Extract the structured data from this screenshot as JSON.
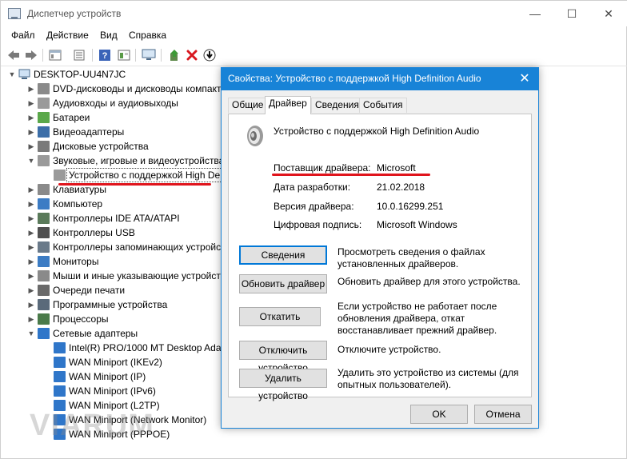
{
  "window": {
    "title": "Диспетчер устройств",
    "minimize": "—",
    "maximize": "☐",
    "close": "✕"
  },
  "menu": [
    "Файл",
    "Действие",
    "Вид",
    "Справка"
  ],
  "tree": {
    "root": "DESKTOP-UU4N7JC",
    "items": [
      {
        "label": "DVD-дисководы и дисководы компакт",
        "icon": "dvd-drive-icon",
        "expanded": false
      },
      {
        "label": "Аудиовходы и аудиовыходы",
        "icon": "speaker-icon",
        "expanded": false
      },
      {
        "label": "Батареи",
        "icon": "battery-icon",
        "expanded": false
      },
      {
        "label": "Видеоадаптеры",
        "icon": "display-adapter-icon",
        "expanded": false
      },
      {
        "label": "Дисковые устройства",
        "icon": "disk-drive-icon",
        "expanded": false
      },
      {
        "label": "Звуковые, игровые и видеоустройства",
        "icon": "speaker-icon",
        "expanded": true
      },
      {
        "label": "Устройство с поддержкой High De",
        "icon": "speaker-icon",
        "child": true,
        "selected": true
      },
      {
        "label": "Клавиатуры",
        "icon": "keyboard-icon",
        "expanded": false
      },
      {
        "label": "Компьютер",
        "icon": "computer-icon",
        "expanded": false
      },
      {
        "label": "Контроллеры IDE ATA/ATAPI",
        "icon": "controller-icon",
        "expanded": false
      },
      {
        "label": "Контроллеры USB",
        "icon": "usb-icon",
        "expanded": false
      },
      {
        "label": "Контроллеры запоминающих устройств",
        "icon": "storage-controller-icon",
        "expanded": false
      },
      {
        "label": "Мониторы",
        "icon": "monitor-icon",
        "expanded": false
      },
      {
        "label": "Мыши и иные указывающие устройст",
        "icon": "mouse-icon",
        "expanded": false
      },
      {
        "label": "Очереди печати",
        "icon": "printer-icon",
        "expanded": false
      },
      {
        "label": "Программные устройства",
        "icon": "software-device-icon",
        "expanded": false
      },
      {
        "label": "Процессоры",
        "icon": "processor-icon",
        "expanded": false
      },
      {
        "label": "Сетевые адаптеры",
        "icon": "network-adapter-icon",
        "expanded": true
      },
      {
        "label": "Intel(R) PRO/1000 MT Desktop Adap",
        "icon": "network-adapter-icon",
        "child": true
      },
      {
        "label": "WAN Miniport (IKEv2)",
        "icon": "network-adapter-icon",
        "child": true
      },
      {
        "label": "WAN Miniport (IP)",
        "icon": "network-adapter-icon",
        "child": true
      },
      {
        "label": "WAN Miniport (IPv6)",
        "icon": "network-adapter-icon",
        "child": true
      },
      {
        "label": "WAN Miniport (L2TP)",
        "icon": "network-adapter-icon",
        "child": true
      },
      {
        "label": "WAN Miniport (Network Monitor)",
        "icon": "network-adapter-icon",
        "child": true
      },
      {
        "label": "WAN Miniport (PPPOE)",
        "icon": "network-adapter-icon",
        "child": true
      }
    ]
  },
  "dialog": {
    "title": "Свойства: Устройство с поддержкой High Definition Audio",
    "close": "✕",
    "tabs": [
      "Общие",
      "Драйвер",
      "Сведения",
      "События"
    ],
    "active_tab": "Драйвер",
    "device_name": "Устройство с поддержкой High Definition Audio",
    "properties": [
      {
        "label": "Поставщик драйвера:",
        "value": "Microsoft"
      },
      {
        "label": "Дата разработки:",
        "value": "21.02.2018"
      },
      {
        "label": "Версия драйвера:",
        "value": "10.0.16299.251"
      },
      {
        "label": "Цифровая подпись:",
        "value": "Microsoft Windows"
      }
    ],
    "actions": [
      {
        "label": "Сведения",
        "desc": "Просмотреть сведения о файлах установленных драйверов."
      },
      {
        "label": "Обновить драйвер",
        "desc": "Обновить драйвер для этого устройства."
      },
      {
        "label": "Откатить",
        "desc": "Если устройство не работает после обновления драйвера, откат восстанавливает прежний драйвер."
      },
      {
        "label": "Отключить устройство",
        "desc": "Отключите устройство."
      },
      {
        "label": "Удалить устройство",
        "desc": "Удалить это устройство из системы (для опытных пользователей)."
      }
    ],
    "ok": "OK",
    "cancel": "Отмена"
  },
  "watermark": "VIARUM",
  "colors": {
    "dialog_accent": "#1883d7",
    "annotation_red": "#e0141c"
  }
}
